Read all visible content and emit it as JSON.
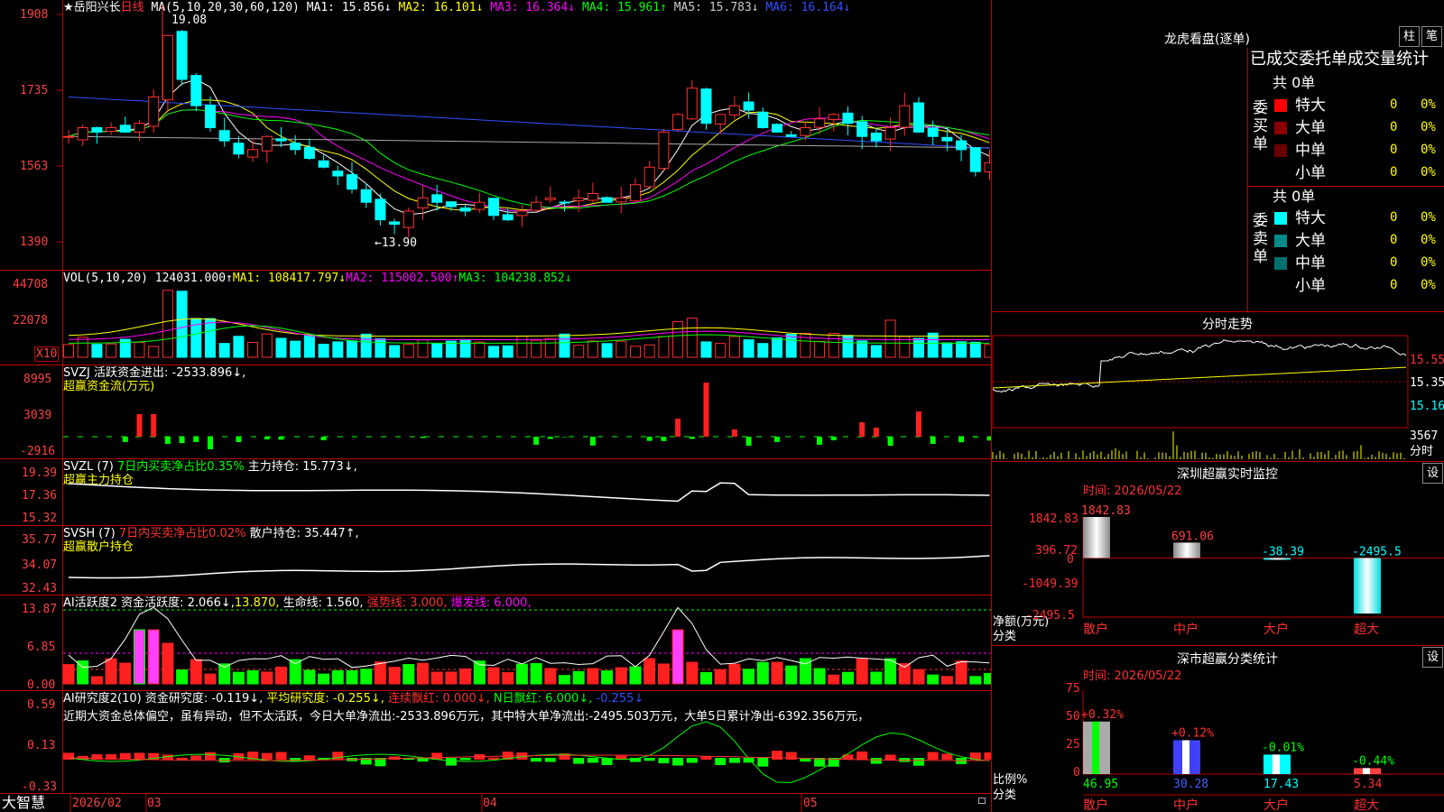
{
  "main": {
    "title": "★岳阳兴长",
    "period": "日线",
    "ma_params": "MA(5,10,20,30,60,120)",
    "ma": [
      {
        "t": "MA1: 15.856↓",
        "c": "#ffffff"
      },
      {
        "t": "MA2: 16.101↓",
        "c": "#ffff00"
      },
      {
        "t": "MA3: 16.364↓",
        "c": "#ff00ff"
      },
      {
        "t": "MA4: 15.961↑",
        "c": "#00ff00"
      },
      {
        "t": "MA5: 15.783↓",
        "c": "#cccccc"
      },
      {
        "t": "MA6: 16.164↓",
        "c": "#3050ff"
      }
    ],
    "axis": [
      "1908",
      "1735",
      "1563",
      "1390"
    ],
    "high_label": "19.08",
    "low_label": "←13.90"
  },
  "vol": {
    "params": "VOL(5,10,20)",
    "value": "124031.000↑",
    "ma1": "MA1: 108417.797↓",
    "ma2": "MA2: 115002.500↑",
    "ma3": "MA3: 104238.852↓",
    "axis": [
      "44708",
      "22078"
    ],
    "unit": "X10"
  },
  "svzj": {
    "line1": "SVZJ  活跃资金进出: -2533.896↓,",
    "line2": "超赢资金流(万元)",
    "axis": [
      "8995",
      "3039",
      "-2916"
    ]
  },
  "svzl": {
    "name": "SVZL (7)",
    "ratio": "7日内买卖净占比0.35%",
    "hold": "主力持仓: 15.773↓,",
    "line2": "超赢主力持仓",
    "axis": [
      "19.39",
      "17.36",
      "15.32"
    ]
  },
  "svsh": {
    "name": "SVSH (7)",
    "ratio": "7日内买卖净占比0.02%",
    "hold": "散户持仓: 35.447↑,",
    "line2": "超赢散户持仓",
    "axis": [
      "35.77",
      "34.07",
      "32.43"
    ]
  },
  "ai1": {
    "name": "AI活跃度2",
    "v1": "资金活跃度: 2.066↓,",
    "v2": "13.870,",
    "v3": "生命线: 1.560,",
    "v4": "强势线: 3.000,",
    "v5": "爆发线: 6.000,",
    "axis": [
      "13.87",
      "6.85",
      "0.00"
    ]
  },
  "ai2": {
    "name": "AI研究度2(10)",
    "v1": "资金研究度: -0.119↓,",
    "v2": "平均研究度: -0.255↓,",
    "v3": "连续飘红: 0.000↓,",
    "v4": "N日飘红: 6.000↓,",
    "v5": "-0.255↓",
    "text": "近期大资金总体偏空，虽有异动，但不太活跃，今日大单净流出:-2533.896万元，其中特大单净流出:-2495.503万元，大单5日累计净出-6392.356万元，",
    "axis": [
      "0.59",
      "0.13",
      "-0.33"
    ]
  },
  "bottom": {
    "brand": "大智慧",
    "dates": [
      "2026/02",
      "03",
      "04",
      "05"
    ]
  },
  "lhb": {
    "title": "龙虎看盘(逐单)",
    "btn1": "柱",
    "btn2": "笔",
    "header": "已成交委托单成交量统计",
    "buy": {
      "label": "委买单",
      "total": "共 0单",
      "rows": [
        {
          "n": "特大",
          "v": "0",
          "p": "0%",
          "c": "#ff0000"
        },
        {
          "n": "大单",
          "v": "0",
          "p": "0%",
          "c": "#8b0000"
        },
        {
          "n": "中单",
          "v": "0",
          "p": "0%",
          "c": "#6b0000"
        },
        {
          "n": "小单",
          "v": "0",
          "p": "0%",
          "c": "#000000"
        }
      ]
    },
    "sell": {
      "label": "委卖单",
      "total": "共 0单",
      "rows": [
        {
          "n": "特大",
          "v": "0",
          "p": "0%",
          "c": "#00ffff"
        },
        {
          "n": "大单",
          "v": "0",
          "p": "0%",
          "c": "#008b8b"
        },
        {
          "n": "中单",
          "v": "0",
          "p": "0%",
          "c": "#007070"
        },
        {
          "n": "小单",
          "v": "0",
          "p": "0%",
          "c": "#000000"
        }
      ]
    }
  },
  "fs": {
    "title": "分时走势",
    "axis": [
      "15.55",
      "15.35",
      "15.16"
    ],
    "vol": "3567",
    "vol_unit": "分时"
  },
  "sz": {
    "title": "深圳超赢实时监控",
    "btn": "设",
    "time": "时间: 2026/05/22",
    "axis": [
      "1842.83",
      "396.72",
      "0",
      "-1049.39",
      "-2495.5"
    ],
    "unit": "净额(万元)",
    "cat_label": "分类",
    "categories": [
      "散户",
      "中户",
      "大户",
      "超大"
    ],
    "values": [
      1842.83,
      691.06,
      -38.39,
      -2495.5
    ],
    "value_labels": [
      "1842.83",
      "691.06",
      "-38.39",
      "-2495.5"
    ]
  },
  "ss": {
    "title": "深市超赢分类统计",
    "btn": "设",
    "time": "时间: 2026/05/22",
    "axis": [
      "75",
      "50",
      "25",
      "0"
    ],
    "unit": "比例%",
    "cat_label": "分类",
    "categories": [
      "散户",
      "中户",
      "大户",
      "超大"
    ],
    "values": [
      46.95,
      30.28,
      17.43,
      5.34
    ],
    "changes": [
      "+0.32%",
      "+0.12%",
      "-0.01%",
      "-0.44%"
    ]
  },
  "chart_data": {
    "type": "bar",
    "title": "深圳超赢实时监控",
    "categories": [
      "散户",
      "中户",
      "大户",
      "超大"
    ],
    "values": [
      1842.83,
      691.06,
      -38.39,
      -2495.5
    ],
    "ylabel": "净额(万元)",
    "ylim": [
      -2495.5,
      1842.83
    ]
  }
}
